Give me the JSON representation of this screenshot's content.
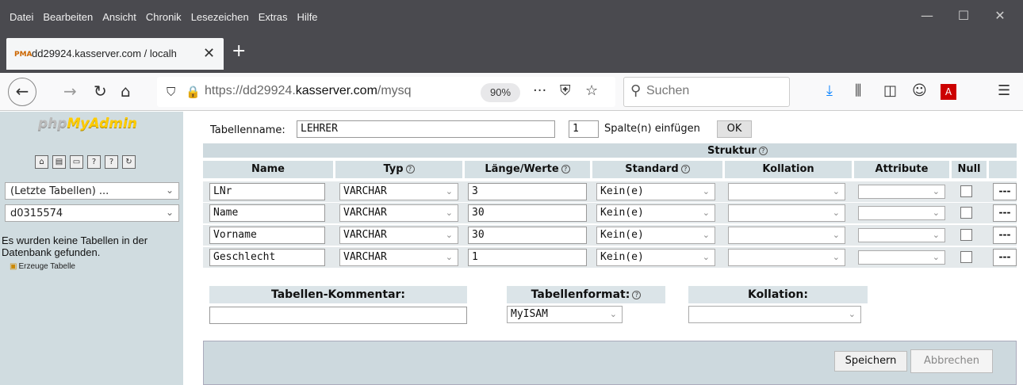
{
  "browser": {
    "menu": [
      "Datei",
      "Bearbeiten",
      "Ansicht",
      "Chronik",
      "Lesezeichen",
      "Extras",
      "Hilfe"
    ],
    "tab_title": "dd29924.kasserver.com / localh",
    "tab_favicon": "PMA",
    "url_prefix": "https://dd29924.",
    "url_domain": "kasserver.com",
    "url_suffix": "/mysq",
    "zoom": "90%",
    "search_placeholder": "Suchen",
    "icons": [
      "back-icon",
      "forward-icon",
      "reload-icon",
      "home-icon",
      "shield-icon",
      "lock-icon",
      "more-icon",
      "pocket-icon",
      "star-icon",
      "download-icon",
      "library-icon",
      "sidebar-icon",
      "account-icon",
      "pdf-icon",
      "hamburger-menu-icon"
    ],
    "colors": {
      "chrome": "#4a4a4f",
      "accent": "#0a84ff"
    }
  },
  "sidebar": {
    "logo_php": "php",
    "logo_myadmin": "MyAdmin",
    "recent_tables": "(Letzte Tabellen) ...",
    "database": "d0315574",
    "no_tables_msg": "Es wurden keine Tabellen in der Datenbank gefunden.",
    "create_table": "Erzeuge Tabelle",
    "colors": {
      "bg": "#d0dce0"
    }
  },
  "form": {
    "table_name_label": "Tabellenname:",
    "table_name_value": "LEHRER",
    "add_count": "1",
    "add_columns_label": "Spalte(n) einfügen",
    "ok_label": "OK",
    "structure_label": "Struktur",
    "headers": {
      "name": "Name",
      "type": "Typ",
      "length": "Länge/Werte",
      "default": "Standard",
      "collation": "Kollation",
      "attributes": "Attribute",
      "null": "Null"
    },
    "rows": [
      {
        "name": "LNr",
        "type": "VARCHAR",
        "length": "3",
        "default": "Kein(e)",
        "more": "---"
      },
      {
        "name": "Name",
        "type": "VARCHAR",
        "length": "30",
        "default": "Kein(e)",
        "more": "---"
      },
      {
        "name": "Vorname",
        "type": "VARCHAR",
        "length": "30",
        "default": "Kein(e)",
        "more": "---"
      },
      {
        "name": "Geschlecht",
        "type": "VARCHAR",
        "length": "1",
        "default": "Kein(e)",
        "more": "---"
      }
    ],
    "table_comment_label": "Tabellen-Kommentar:",
    "table_format_label": "Tabellenformat:",
    "table_format_value": "MyISAM",
    "table_collation_label": "Kollation:",
    "save_label": "Speichern",
    "cancel_label": "Abbrechen"
  }
}
